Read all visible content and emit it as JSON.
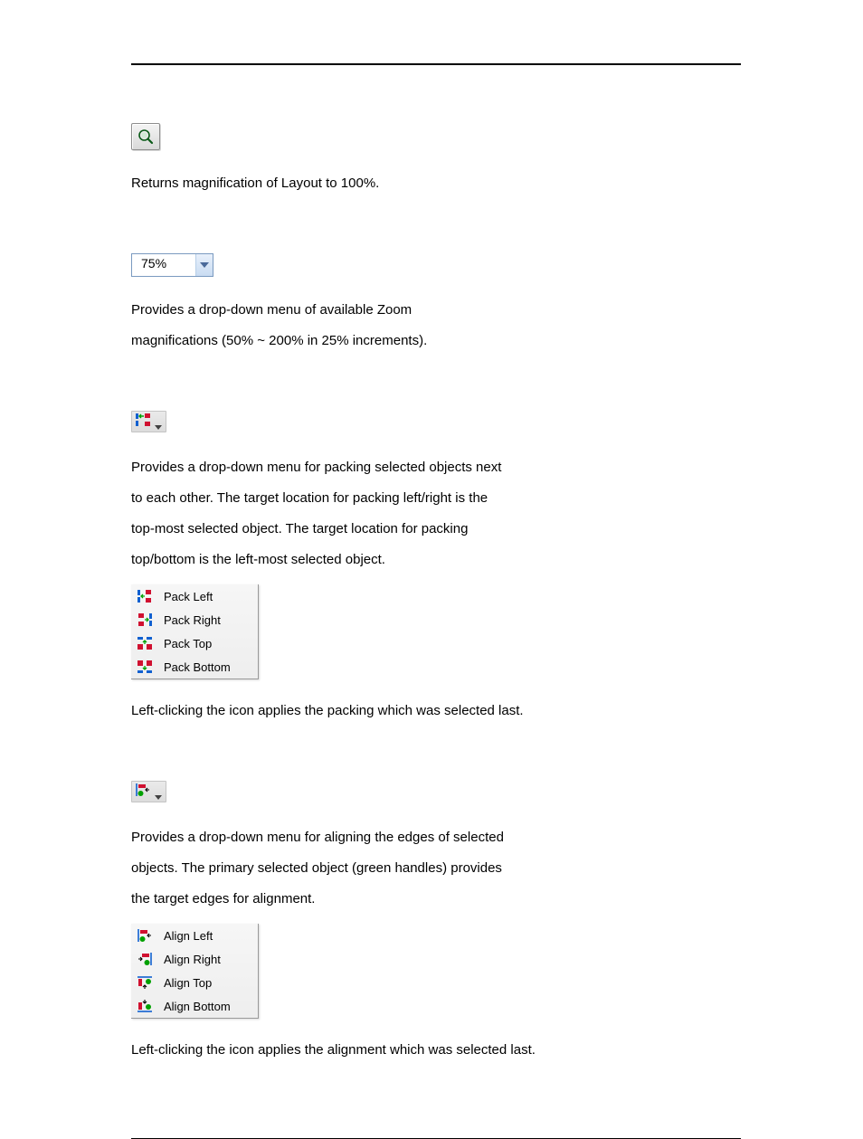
{
  "zoom100": {
    "desc": "Returns magnification of Layout to 100%."
  },
  "zoomdd": {
    "value": "75%",
    "desc1": "Provides a drop-down menu of available Zoom",
    "desc2": "magnifications (50% ~ 200% in 25% increments)."
  },
  "pack": {
    "desc1": "Provides a drop-down menu for packing selected objects next",
    "desc2": "to each other. The target location for packing left/right is the",
    "desc3": "top-most selected object. The target location for packing",
    "desc4": "top/bottom is the left-most selected object.",
    "items": [
      "Pack Left",
      "Pack Right",
      "Pack Top",
      "Pack Bottom"
    ],
    "foot": "Left-clicking the icon applies the packing which was selected last."
  },
  "align": {
    "desc1": "Provides a drop-down menu for aligning the edges of selected",
    "desc2": "objects. The primary selected object (green handles) provides",
    "desc3": "the target edges for alignment.",
    "items": [
      "Align Left",
      "Align Right",
      "Align Top",
      "Align Bottom"
    ],
    "foot": "Left-clicking the icon applies the alignment which was selected last."
  }
}
